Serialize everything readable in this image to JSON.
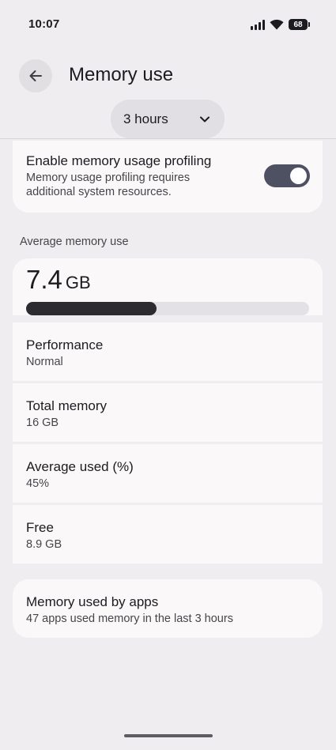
{
  "status_bar": {
    "time": "10:07",
    "battery": "68"
  },
  "header": {
    "title": "Memory use",
    "back_icon": "arrow-back-icon"
  },
  "period_dropdown": {
    "selected": "3 hours",
    "icon": "chevron-down-icon"
  },
  "profiling": {
    "title": "Enable memory usage profiling",
    "description": "Memory usage profiling requires additional system resources.",
    "enabled": true
  },
  "average": {
    "section_label": "Average memory use",
    "value": "7.4",
    "unit": "GB",
    "used_fraction": 0.46
  },
  "stats": [
    {
      "label": "Performance",
      "value": "Normal"
    },
    {
      "label": "Total memory",
      "value": "16 GB"
    },
    {
      "label": "Average used (%)",
      "value": "45%"
    },
    {
      "label": "Free",
      "value": "8.9 GB"
    }
  ],
  "apps": {
    "title": "Memory used by apps",
    "subtitle": "47 apps used memory in the last 3 hours"
  },
  "colors": {
    "background": "#efedef",
    "card": "#fbf8fa",
    "toggle_on": "#4e5162",
    "progress_fill": "#2b2b30"
  }
}
